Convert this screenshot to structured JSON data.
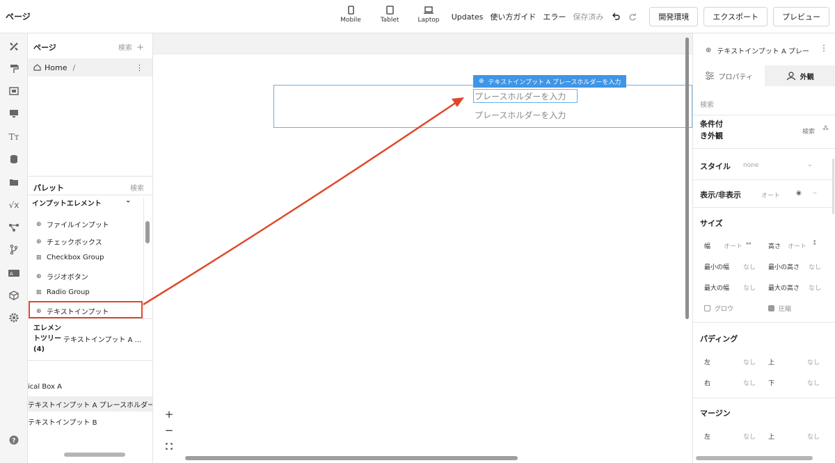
{
  "app": {
    "title": "ページ"
  },
  "devices": [
    {
      "label": "Mobile"
    },
    {
      "label": "Tablet"
    },
    {
      "label": "Laptop"
    }
  ],
  "toolbar": {
    "updates": "Updates",
    "guide": "使い方ガイド",
    "error": "エラー",
    "saved": "保存済み",
    "dev_env": "開発環境",
    "export": "エクスポート",
    "preview": "プレビュー"
  },
  "left": {
    "pages_header": "ページ",
    "search": "検索",
    "home_label": "Home",
    "home_sep": "/",
    "palette_header": "パレット",
    "palette_search": "検索",
    "palette_group": "インプットエレメント",
    "palette_items": [
      {
        "icon": "⊕",
        "label": "ファイルインプット"
      },
      {
        "icon": "⊕",
        "label": "チェックボックス"
      },
      {
        "icon": "⊠",
        "label": "Checkbox Group"
      },
      {
        "icon": "⊕",
        "label": "ラジオボタン"
      },
      {
        "icon": "⊠",
        "label": "Radio Group"
      },
      {
        "icon": "⊕",
        "label": "テキストインプット"
      }
    ],
    "tree_label": "エレメントツリー (4)",
    "tree_value": "テキストインプット A ...",
    "layers": [
      {
        "label": "ical Box A"
      },
      {
        "label": "テキストインプット A プレースホルダー"
      },
      {
        "label": "テキストインプット B"
      }
    ]
  },
  "canvas": {
    "element_tag": "テキストインプット A プレースホルダーを入力",
    "input_a_placeholder": "プレースホルダーを入力",
    "input_b_placeholder": "プレースホルダーを入力",
    "zoom_in": "+",
    "zoom_out": "−",
    "fit": "⛶"
  },
  "right": {
    "title": "テキストインプット A プレー",
    "tab_properties": "プロパティ",
    "tab_appearance": "外観",
    "search": "検索",
    "conditional": "条件付き外観",
    "conditional_search": "検索",
    "style_label": "スタイル",
    "style_value": "none",
    "visibility_label": "表示/非表示",
    "visibility_value": "オート",
    "size_label": "サイズ",
    "width_label": "幅",
    "width_value": "オート",
    "height_label": "高さ",
    "height_value": "オート",
    "min_width_label": "最小の幅",
    "min_width_value": "なし",
    "min_height_label": "最小の高さ",
    "min_height_value": "なし",
    "max_width_label": "最大の幅",
    "max_width_value": "なし",
    "max_height_label": "最大の高さ",
    "max_height_value": "なし",
    "grow_label": "グロウ",
    "shrink_label": "圧縮",
    "padding_label": "パディング",
    "left_label": "左",
    "right_label": "右",
    "top_label": "上",
    "bottom_label": "下",
    "none": "なし",
    "margin_label": "マージン"
  },
  "colors": {
    "accent": "#3f95e6",
    "annotation": "#e0472a"
  }
}
